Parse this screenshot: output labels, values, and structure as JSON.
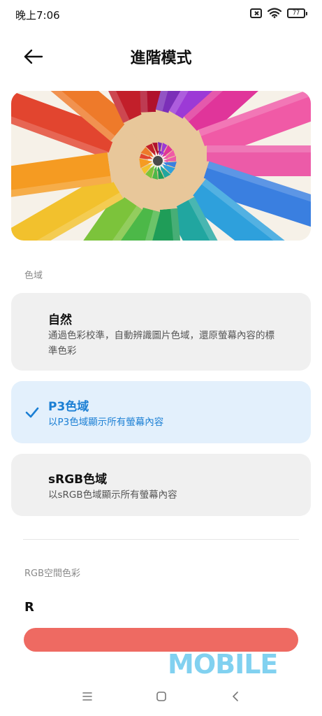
{
  "status_bar": {
    "time": "晚上7:06",
    "battery": "77",
    "icons": [
      "sim-off-icon",
      "wifi-icon",
      "battery-icon"
    ]
  },
  "header": {
    "title": "進階模式",
    "back_icon": "arrow-left-icon"
  },
  "color_gamut": {
    "section_label": "色域",
    "options": [
      {
        "title": "自然",
        "description": "通過色彩校準，自動辨識圖片色域，還原螢幕內容的標準色彩",
        "selected": false
      },
      {
        "title": "P3色域",
        "description": "以P3色域顯示所有螢幕內容",
        "selected": true
      },
      {
        "title": "sRGB色域",
        "description": "以sRGB色域顯示所有螢幕內容",
        "selected": false
      }
    ]
  },
  "rgb_space": {
    "section_label": "RGB空間色彩",
    "channel_label": "R",
    "slider_color": "#ee6a62"
  },
  "watermark": "MOBILE",
  "nav_bar": {
    "icons": [
      "menu-icon",
      "home-square-icon",
      "back-chevron-icon"
    ]
  },
  "colors": {
    "accent": "#1b7fd4",
    "card_bg": "#f0f0f0",
    "selected_card_bg": "#e3f0fc"
  }
}
